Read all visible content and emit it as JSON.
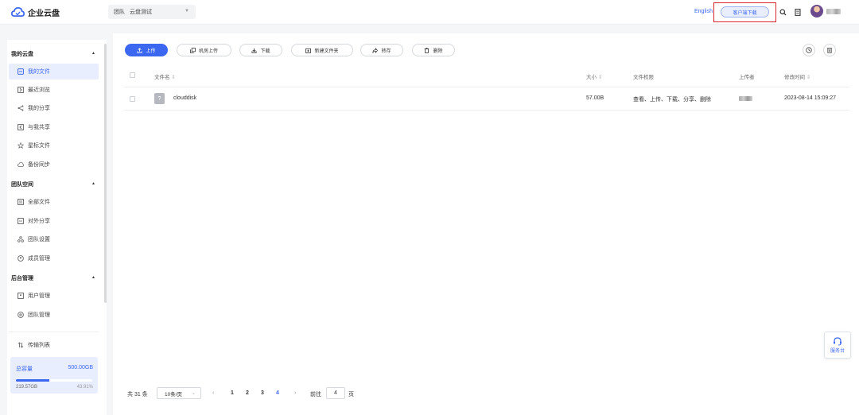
{
  "app": {
    "name": "企业云盘",
    "brand_color": "#3c67f0"
  },
  "header": {
    "team_label": "团队",
    "team_name": "云盘测试",
    "lang_link": "English",
    "client_download": "客户端下载",
    "icons": [
      "search-icon",
      "document-icon",
      "avatar"
    ]
  },
  "sidebar": {
    "sections": [
      {
        "title": "我的云盘",
        "items": [
          {
            "label": "我的文件",
            "icon": "file-icon",
            "active": true
          },
          {
            "label": "最近浏览",
            "icon": "recent-icon"
          },
          {
            "label": "我的分享",
            "icon": "share-icon"
          },
          {
            "label": "与我共享",
            "icon": "shared-with-me-icon"
          },
          {
            "label": "星标文件",
            "icon": "star-icon"
          },
          {
            "label": "备份同步",
            "icon": "cloud-sync-icon"
          }
        ]
      },
      {
        "title": "团队空间",
        "items": [
          {
            "label": "全部文件",
            "icon": "all-files-icon"
          },
          {
            "label": "对外分享",
            "icon": "external-share-icon"
          },
          {
            "label": "团队设置",
            "icon": "team-settings-icon"
          },
          {
            "label": "成员管理",
            "icon": "members-icon"
          }
        ]
      },
      {
        "title": "后台管理",
        "items": [
          {
            "label": "用户管理",
            "icon": "user-admin-icon"
          },
          {
            "label": "团队管理",
            "icon": "team-admin-icon"
          }
        ]
      }
    ],
    "transfer_list": "传输列表",
    "quota": {
      "label": "总容量",
      "total": "500.00GB",
      "used": "219.57GB",
      "percent_text": "43.91%",
      "fill": 0.4391
    }
  },
  "toolbar": {
    "upload": "上传",
    "local_upload": "机房上传",
    "download": "下载",
    "new_folder": "新建文件夹",
    "transfer": "转存",
    "delete": "删除"
  },
  "table": {
    "headers": {
      "name": "文件名",
      "size": "大小",
      "permission": "文件权限",
      "uploader": "上传者",
      "modified": "修改时间"
    },
    "rows": [
      {
        "name": "clouddisk",
        "size": "57.00B",
        "permission": "查看、上传、下载、分享、删除",
        "modified": "2023-08-14 15:09:27",
        "type_icon": "?"
      }
    ]
  },
  "pagination": {
    "total": "共 31 条",
    "page_size": "10条/页",
    "pages": [
      "1",
      "2",
      "3",
      "4"
    ],
    "current": "4",
    "goto_label": "前往",
    "goto_value": "4",
    "page_unit": "页"
  },
  "service": {
    "label": "服务台"
  }
}
